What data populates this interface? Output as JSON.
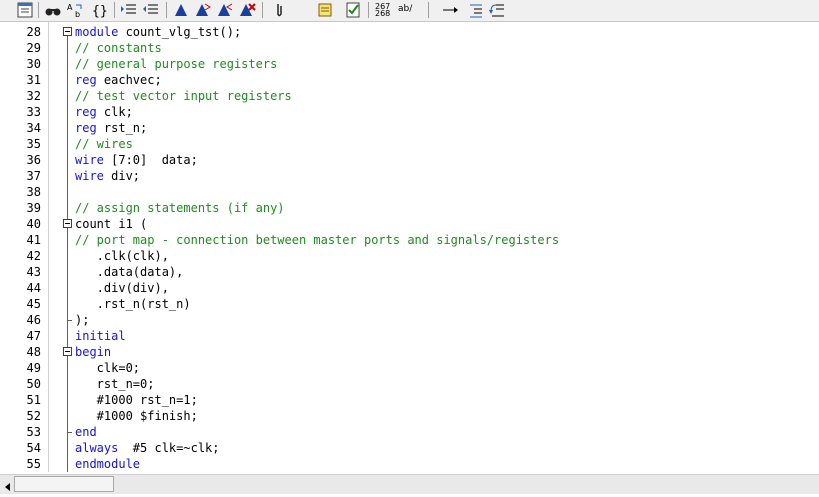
{
  "toolbar": {
    "buttons": [
      {
        "name": "window-icon"
      },
      {
        "name": "find-icon"
      },
      {
        "name": "replace-icon"
      },
      {
        "name": "braces-icon"
      },
      {
        "name": "indent-icon"
      },
      {
        "name": "unindent-icon"
      },
      {
        "name": "bookmark-toggle-icon"
      },
      {
        "name": "bookmark-next-icon"
      },
      {
        "name": "bookmark-prev-icon"
      },
      {
        "name": "bookmark-clear-icon"
      },
      {
        "name": "attach-icon"
      },
      {
        "name": "template-icon"
      },
      {
        "name": "checklist-icon"
      },
      {
        "name": "line-numbers-icon"
      },
      {
        "name": "spelling-icon"
      },
      {
        "name": "arrow-right-icon"
      },
      {
        "name": "align-icon"
      },
      {
        "name": "undo-indent-icon"
      }
    ],
    "line_numbers_label_top": "267",
    "line_numbers_label_bottom": "268",
    "spelling_label": "ab/"
  },
  "colors": {
    "keyword": "#1414d2",
    "comment": "#1e8c1e",
    "text": "#000000"
  },
  "editor": {
    "lines": [
      {
        "num": "28",
        "parts": [
          {
            "t": "kw",
            "s": "module"
          },
          {
            "t": "pl",
            "s": " count_vlg_tst();"
          }
        ],
        "fold": "start"
      },
      {
        "num": "29",
        "parts": [
          {
            "t": "cm",
            "s": "// constants"
          }
        ]
      },
      {
        "num": "30",
        "parts": [
          {
            "t": "cm",
            "s": "// general purpose registers"
          }
        ]
      },
      {
        "num": "31",
        "parts": [
          {
            "t": "kw",
            "s": "reg"
          },
          {
            "t": "pl",
            "s": " eachvec;"
          }
        ]
      },
      {
        "num": "32",
        "parts": [
          {
            "t": "cm",
            "s": "// test vector input registers"
          }
        ]
      },
      {
        "num": "33",
        "parts": [
          {
            "t": "kw",
            "s": "reg"
          },
          {
            "t": "pl",
            "s": " clk;"
          }
        ]
      },
      {
        "num": "34",
        "parts": [
          {
            "t": "kw",
            "s": "reg"
          },
          {
            "t": "pl",
            "s": " rst_n;"
          }
        ]
      },
      {
        "num": "35",
        "parts": [
          {
            "t": "cm",
            "s": "// wires"
          }
        ]
      },
      {
        "num": "36",
        "parts": [
          {
            "t": "kw",
            "s": "wire"
          },
          {
            "t": "pl",
            "s": " [7:0]  data;"
          }
        ]
      },
      {
        "num": "37",
        "parts": [
          {
            "t": "kw",
            "s": "wire"
          },
          {
            "t": "pl",
            "s": " div;"
          }
        ]
      },
      {
        "num": "38",
        "parts": []
      },
      {
        "num": "39",
        "parts": [
          {
            "t": "cm",
            "s": "// assign statements (if any)"
          }
        ]
      },
      {
        "num": "40",
        "parts": [
          {
            "t": "pl",
            "s": "count i1 ("
          }
        ],
        "fold": "start"
      },
      {
        "num": "41",
        "parts": [
          {
            "t": "cm",
            "s": "// port map - connection between master ports and signals/registers"
          }
        ]
      },
      {
        "num": "42",
        "parts": [
          {
            "t": "pl",
            "s": "   .clk(clk),"
          }
        ]
      },
      {
        "num": "43",
        "parts": [
          {
            "t": "pl",
            "s": "   .data(data),"
          }
        ]
      },
      {
        "num": "44",
        "parts": [
          {
            "t": "pl",
            "s": "   .div(div),"
          }
        ]
      },
      {
        "num": "45",
        "parts": [
          {
            "t": "pl",
            "s": "   .rst_n(rst_n)"
          }
        ]
      },
      {
        "num": "46",
        "parts": [
          {
            "t": "pl",
            "s": ");"
          }
        ],
        "fold": "end"
      },
      {
        "num": "47",
        "parts": [
          {
            "t": "kw",
            "s": "initial"
          }
        ]
      },
      {
        "num": "48",
        "parts": [
          {
            "t": "kw",
            "s": "begin"
          }
        ],
        "fold": "start"
      },
      {
        "num": "49",
        "parts": [
          {
            "t": "pl",
            "s": "   clk=0;"
          }
        ]
      },
      {
        "num": "50",
        "parts": [
          {
            "t": "pl",
            "s": "   rst_n=0;"
          }
        ]
      },
      {
        "num": "51",
        "parts": [
          {
            "t": "pl",
            "s": "   #1000 rst_n=1;"
          }
        ]
      },
      {
        "num": "52",
        "parts": [
          {
            "t": "pl",
            "s": "   #1000 $finish;"
          }
        ]
      },
      {
        "num": "53",
        "parts": [
          {
            "t": "kw",
            "s": "end"
          }
        ],
        "fold": "end"
      },
      {
        "num": "54",
        "parts": [
          {
            "t": "kw",
            "s": "always"
          },
          {
            "t": "pl",
            "s": "  #5 clk=~clk;"
          }
        ]
      },
      {
        "num": "55",
        "parts": [
          {
            "t": "kw",
            "s": "endmodule"
          }
        ]
      }
    ]
  }
}
